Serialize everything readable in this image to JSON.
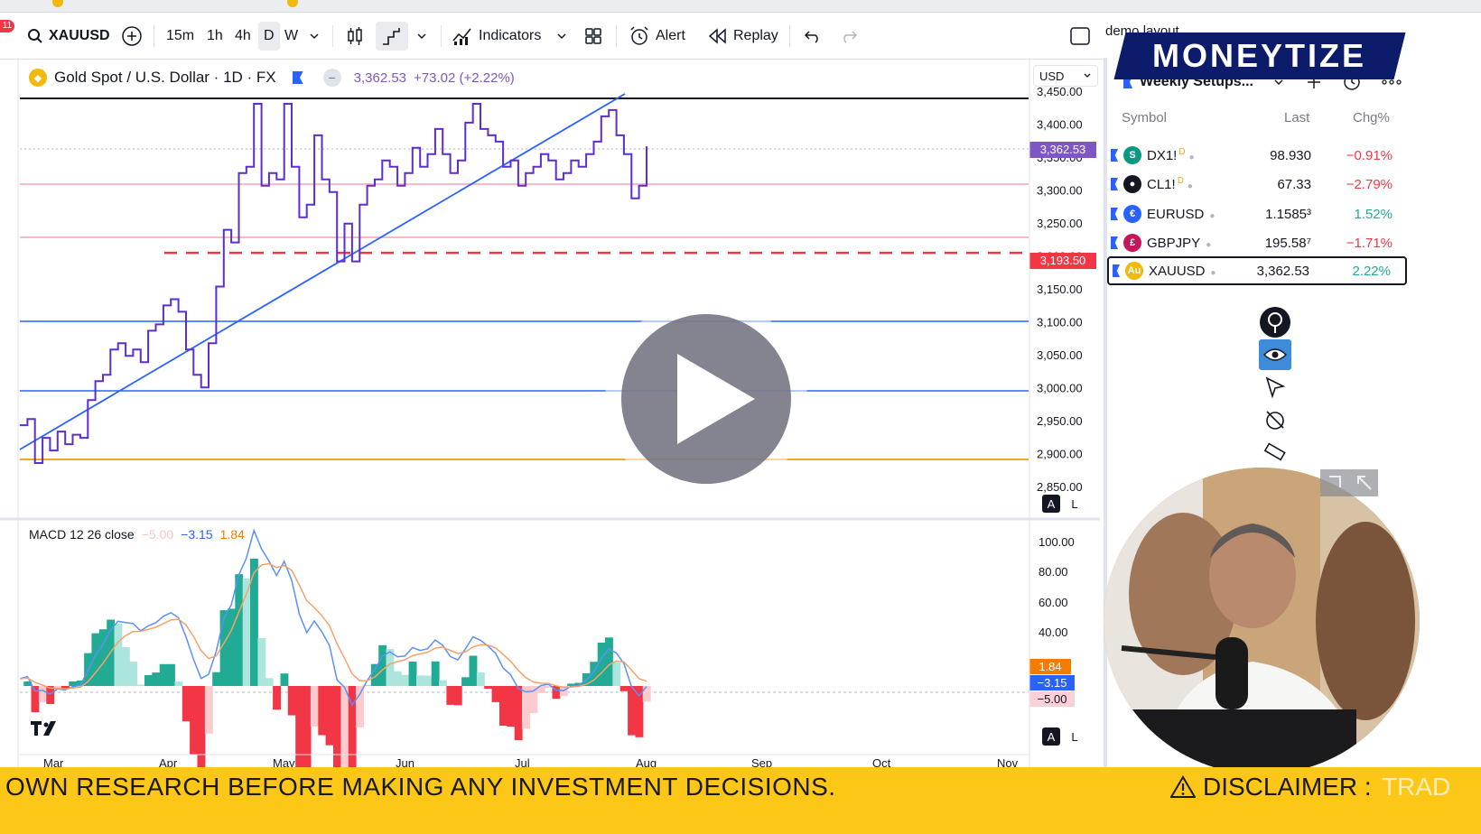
{
  "toolbar": {
    "badge": "11",
    "symbol": "XAUUSD",
    "intervals": [
      "15m",
      "1h",
      "4h",
      "D",
      "W"
    ],
    "active_interval": "D",
    "indicators_label": "Indicators",
    "alert_label": "Alert",
    "replay_label": "Replay",
    "layout_name": "demo layout"
  },
  "legend": {
    "title": "Gold Spot / U.S. Dollar · 1D · FX",
    "price": "3,362.53",
    "change": "+73.02 (+2.22%)"
  },
  "currency": "USD",
  "price_axis": {
    "ticks": [
      "3,450.00",
      "3,400.00",
      "3,350.00",
      "3,300.00",
      "3,250.00",
      "3,200.00",
      "3,150.00",
      "3,100.00",
      "3,050.00",
      "3,000.00",
      "2,950.00",
      "2,900.00",
      "2,850.00"
    ],
    "current_tag": "3,362.53",
    "current_color": "#7e57c2",
    "level_tag": "3,193.50",
    "level_color": "#f23645"
  },
  "macd": {
    "label": "MACD 12 26 close",
    "hist_value": "−5.00",
    "macd_value": "−3.15",
    "signal_value": "1.84",
    "ticks": [
      "100.00",
      "80.00",
      "60.00",
      "40.00"
    ],
    "tag_signal": "1.84",
    "tag_macd": "−3.15",
    "tag_hist": "−5.00"
  },
  "months": [
    "Mar",
    "Apr",
    "May",
    "Jun",
    "Jul",
    "Aug",
    "Sep",
    "Oct",
    "Nov"
  ],
  "scale_buttons": {
    "auto": "A",
    "log": "L"
  },
  "watchlist": {
    "title": "Weekly Setups...",
    "columns": {
      "symbol": "Symbol",
      "last": "Last",
      "chg": "Chg%"
    },
    "rows": [
      {
        "symbol": "DX1!",
        "sup": "D",
        "last": "98.930",
        "chg": "−0.91%",
        "dir": "neg",
        "icon": "S",
        "icon_color": "#089981"
      },
      {
        "symbol": "CL1!",
        "sup": "D",
        "last": "67.33",
        "chg": "−2.79%",
        "dir": "neg",
        "icon": "●",
        "icon_color": "#131722"
      },
      {
        "symbol": "EURUSD",
        "sup": "",
        "last": "1.1585³",
        "chg": "1.52%",
        "dir": "pos",
        "icon": "€",
        "icon_color": "#2962ff"
      },
      {
        "symbol": "GBPJPY",
        "sup": "",
        "last": "195.58⁷",
        "chg": "−1.71%",
        "dir": "neg",
        "icon": "£",
        "icon_color": "#c2185b"
      },
      {
        "symbol": "XAUUSD",
        "sup": "",
        "last": "3,362.53",
        "chg": "2.22%",
        "dir": "pos",
        "icon": "Au",
        "icon_color": "#f0b90b"
      }
    ]
  },
  "overlay": {
    "brand": "MONEYTIZE",
    "ticker_text": "OWN RESEARCH BEFORE MAKING ANY INVESTMENT DECISIONS.",
    "disclaimer": "DISCLAIMER :",
    "trailing": "TRAD"
  },
  "chart_data": {
    "type": "line",
    "title": "Gold Spot / U.S. Dollar · 1D · FX",
    "xlabel": "",
    "ylabel": "",
    "ylim": [
      2830,
      3460
    ],
    "x_ticks": [
      "Mar",
      "Apr",
      "May",
      "Jun",
      "Jul",
      "Aug",
      "Sep",
      "Oct",
      "Nov"
    ],
    "series": [
      {
        "values": [
          2920,
          2930,
          2860,
          2900,
          2880,
          2910,
          2890,
          2905,
          2900,
          2960,
          2990,
          3000,
          3040,
          3050,
          3030,
          3040,
          3020,
          3070,
          3080,
          3110,
          3120,
          3100,
          3040,
          3000,
          2980,
          3050,
          3140,
          3230,
          3210,
          3320,
          3330,
          3430,
          3300,
          3320,
          3310,
          3430,
          3330,
          3250,
          3270,
          3380,
          3310,
          3290,
          3180,
          3240,
          3180,
          3270,
          3300,
          3310,
          3340,
          3330,
          3300,
          3320,
          3360,
          3330,
          3350,
          3390,
          3350,
          3320,
          3340,
          3400,
          3430,
          3390,
          3380,
          3370,
          3330,
          3340,
          3300,
          3320,
          3330,
          3350,
          3340,
          3310,
          3320,
          3340,
          3330,
          3350,
          3370,
          3410,
          3420,
          3380,
          3350,
          3280,
          3300,
          3362.53
        ]
      }
    ],
    "levels": [
      3193.5
    ],
    "macd_ylim": [
      -15,
      110
    ]
  }
}
